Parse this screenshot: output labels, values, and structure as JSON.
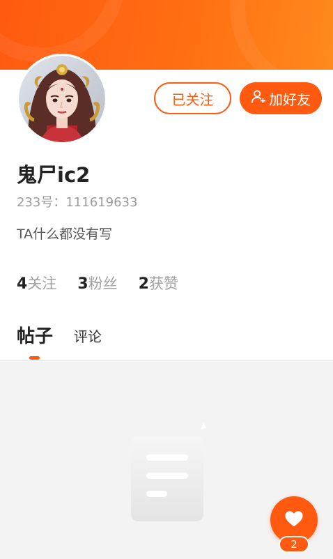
{
  "profile": {
    "username": "鬼尸ic2",
    "account_id": "233号：111619633",
    "bio": "TA什么都没有写"
  },
  "actions": {
    "followed_label": "已关注",
    "add_friend_label": "加好友",
    "add_friend_icon": "add-user-icon"
  },
  "stats": [
    {
      "num": "4",
      "label": "关注"
    },
    {
      "num": "3",
      "label": "粉丝"
    },
    {
      "num": "2",
      "label": "获赞"
    }
  ],
  "tabs": {
    "posts": "帖子",
    "comments": "评论",
    "active": "posts"
  },
  "content": {
    "empty_icon": "empty-document-icon"
  },
  "like_fab": {
    "icon": "heart-icon",
    "count": "2"
  },
  "colors": {
    "accent": "#ff5a10",
    "banner_start": "#ff5a10",
    "banner_end": "#ff8a1c",
    "content_bg": "#f3f3f3"
  }
}
